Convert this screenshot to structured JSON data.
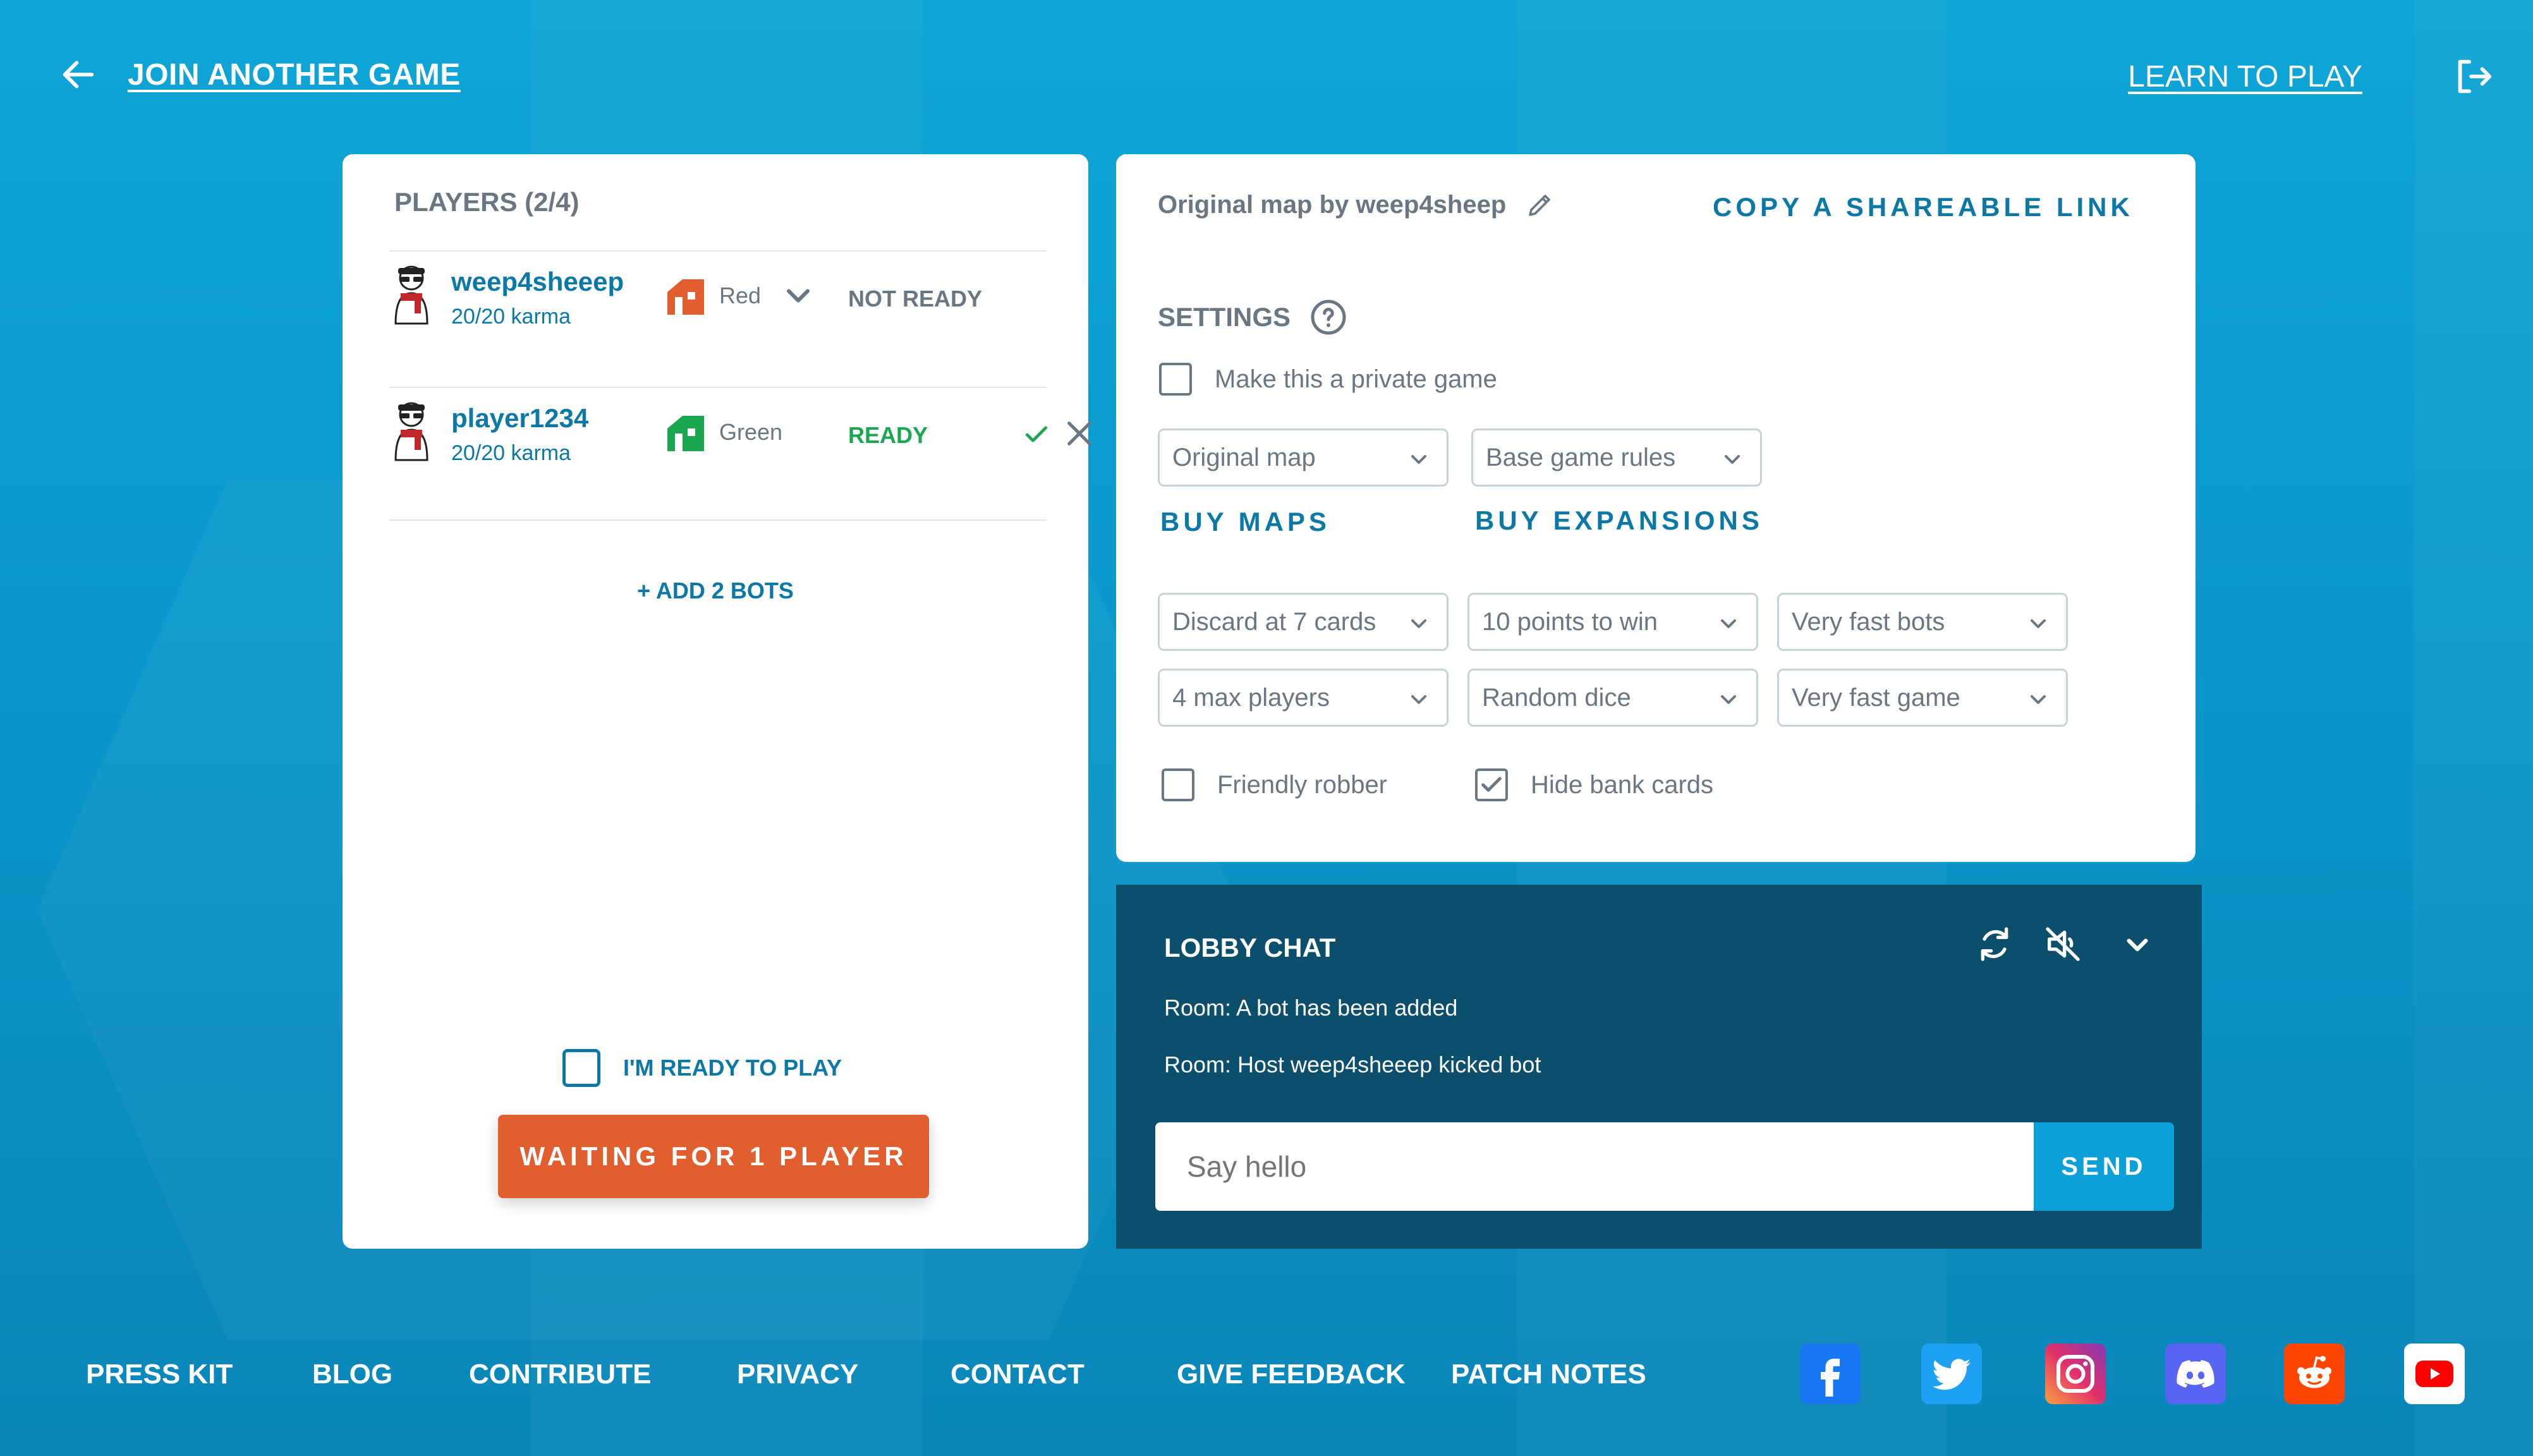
{
  "topbar": {
    "back_label": "JOIN ANOTHER GAME",
    "learn_label": "LEARN TO PLAY"
  },
  "players": {
    "title": "PLAYERS (2/4)",
    "rows": [
      {
        "name": "weep4sheeep",
        "karma": "20/20 karma",
        "color": "Red",
        "color_hex": "#e15f2e",
        "status": "NOT READY"
      },
      {
        "name": "player1234",
        "karma": "20/20 karma",
        "color": "Green",
        "color_hex": "#1aa750",
        "status": "READY"
      }
    ],
    "add_bots": "+ ADD 2 BOTS",
    "ready_label": "I'M READY TO PLAY",
    "ready_checked": false,
    "wait_button": "WAITING FOR 1 PLAYER"
  },
  "settings": {
    "map_by": "Original map by weep4sheep",
    "share_link": "COPY A SHAREABLE LINK",
    "title": "SETTINGS",
    "private_label": "Make this a private game",
    "private_checked": false,
    "map_select": "Original map",
    "rules_select": "Base game rules",
    "buy_maps": "BUY MAPS",
    "buy_expansions": "BUY EXPANSIONS",
    "row1": [
      "Discard at 7 cards",
      "10 points to win",
      "Very fast bots"
    ],
    "row2": [
      "4 max players",
      "Random dice",
      "Very fast game"
    ],
    "friendly_robber_label": "Friendly robber",
    "friendly_robber_checked": false,
    "hide_bank_label": "Hide bank cards",
    "hide_bank_checked": true
  },
  "chat": {
    "title": "LOBBY CHAT",
    "messages": [
      "Room: A bot has been added",
      "Room: Host weep4sheeep kicked bot"
    ],
    "placeholder": "Say hello",
    "send_label": "SEND"
  },
  "footer": {
    "links": [
      "PRESS KIT",
      "BLOG",
      "CONTRIBUTE",
      "PRIVACY",
      "CONTACT",
      "GIVE FEEDBACK",
      "PATCH NOTES"
    ],
    "socials": [
      "facebook-icon",
      "twitter-icon",
      "instagram-icon",
      "discord-icon",
      "reddit-icon",
      "youtube-icon"
    ]
  },
  "colors": {
    "accent": "#0b78a6",
    "orange": "#e15f2e",
    "green": "#1aa750",
    "chat_bg": "#0b4f6c"
  }
}
